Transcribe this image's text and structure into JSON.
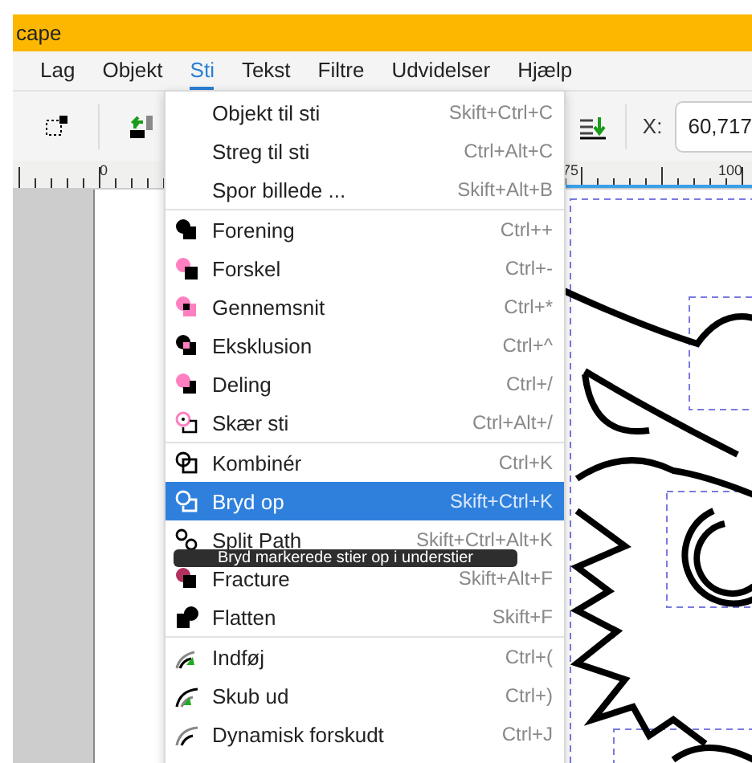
{
  "window": {
    "title": "cape"
  },
  "menubar": [
    {
      "label": "Lag",
      "selected": false
    },
    {
      "label": "Objekt",
      "selected": false
    },
    {
      "label": "Sti",
      "selected": true
    },
    {
      "label": "Tekst",
      "selected": false
    },
    {
      "label": "Filtre",
      "selected": false
    },
    {
      "label": "Udvidelser",
      "selected": false
    },
    {
      "label": "Hjælp",
      "selected": false
    }
  ],
  "toolbar": {
    "x_label": "X:",
    "x_value": "60,717"
  },
  "ruler": {
    "labels": [
      "0",
      "75",
      "100"
    ]
  },
  "menu": {
    "groups": [
      [
        {
          "label": "Objekt til sti",
          "shortcut": "Skift+Ctrl+C",
          "selected": false
        },
        {
          "label": "Streg til sti",
          "shortcut": "Ctrl+Alt+C",
          "selected": false
        },
        {
          "label": "Spor billede ...",
          "shortcut": "Skift+Alt+B",
          "selected": false
        }
      ],
      [
        {
          "label": "Forening",
          "shortcut": "Ctrl++",
          "selected": false
        },
        {
          "label": "Forskel",
          "shortcut": "Ctrl+-",
          "selected": false
        },
        {
          "label": "Gennemsnit",
          "shortcut": "Ctrl+*",
          "selected": false
        },
        {
          "label": "Eksklusion",
          "shortcut": "Ctrl+^",
          "selected": false
        },
        {
          "label": "Deling",
          "shortcut": "Ctrl+/",
          "selected": false
        },
        {
          "label": "Skær sti",
          "shortcut": "Ctrl+Alt+/",
          "selected": false
        }
      ],
      [
        {
          "label": "Kombinér",
          "shortcut": "Ctrl+K",
          "selected": false
        },
        {
          "label": "Bryd op",
          "shortcut": "Skift+Ctrl+K",
          "selected": true
        },
        {
          "label": "Split Path",
          "shortcut": "Skift+Ctrl+Alt+K",
          "selected": false
        },
        {
          "label": "Fracture",
          "shortcut": "Skift+Alt+F",
          "selected": false
        },
        {
          "label": "Flatten",
          "shortcut": "Skift+F",
          "selected": false
        }
      ],
      [
        {
          "label": "Indføj",
          "shortcut": "Ctrl+(",
          "selected": false
        },
        {
          "label": "Skub ud",
          "shortcut": "Ctrl+)",
          "selected": false
        },
        {
          "label": "Dynamisk forskudt",
          "shortcut": "Ctrl+J",
          "selected": false
        }
      ]
    ]
  },
  "tooltip": "Bryd markerede stier op i understier"
}
